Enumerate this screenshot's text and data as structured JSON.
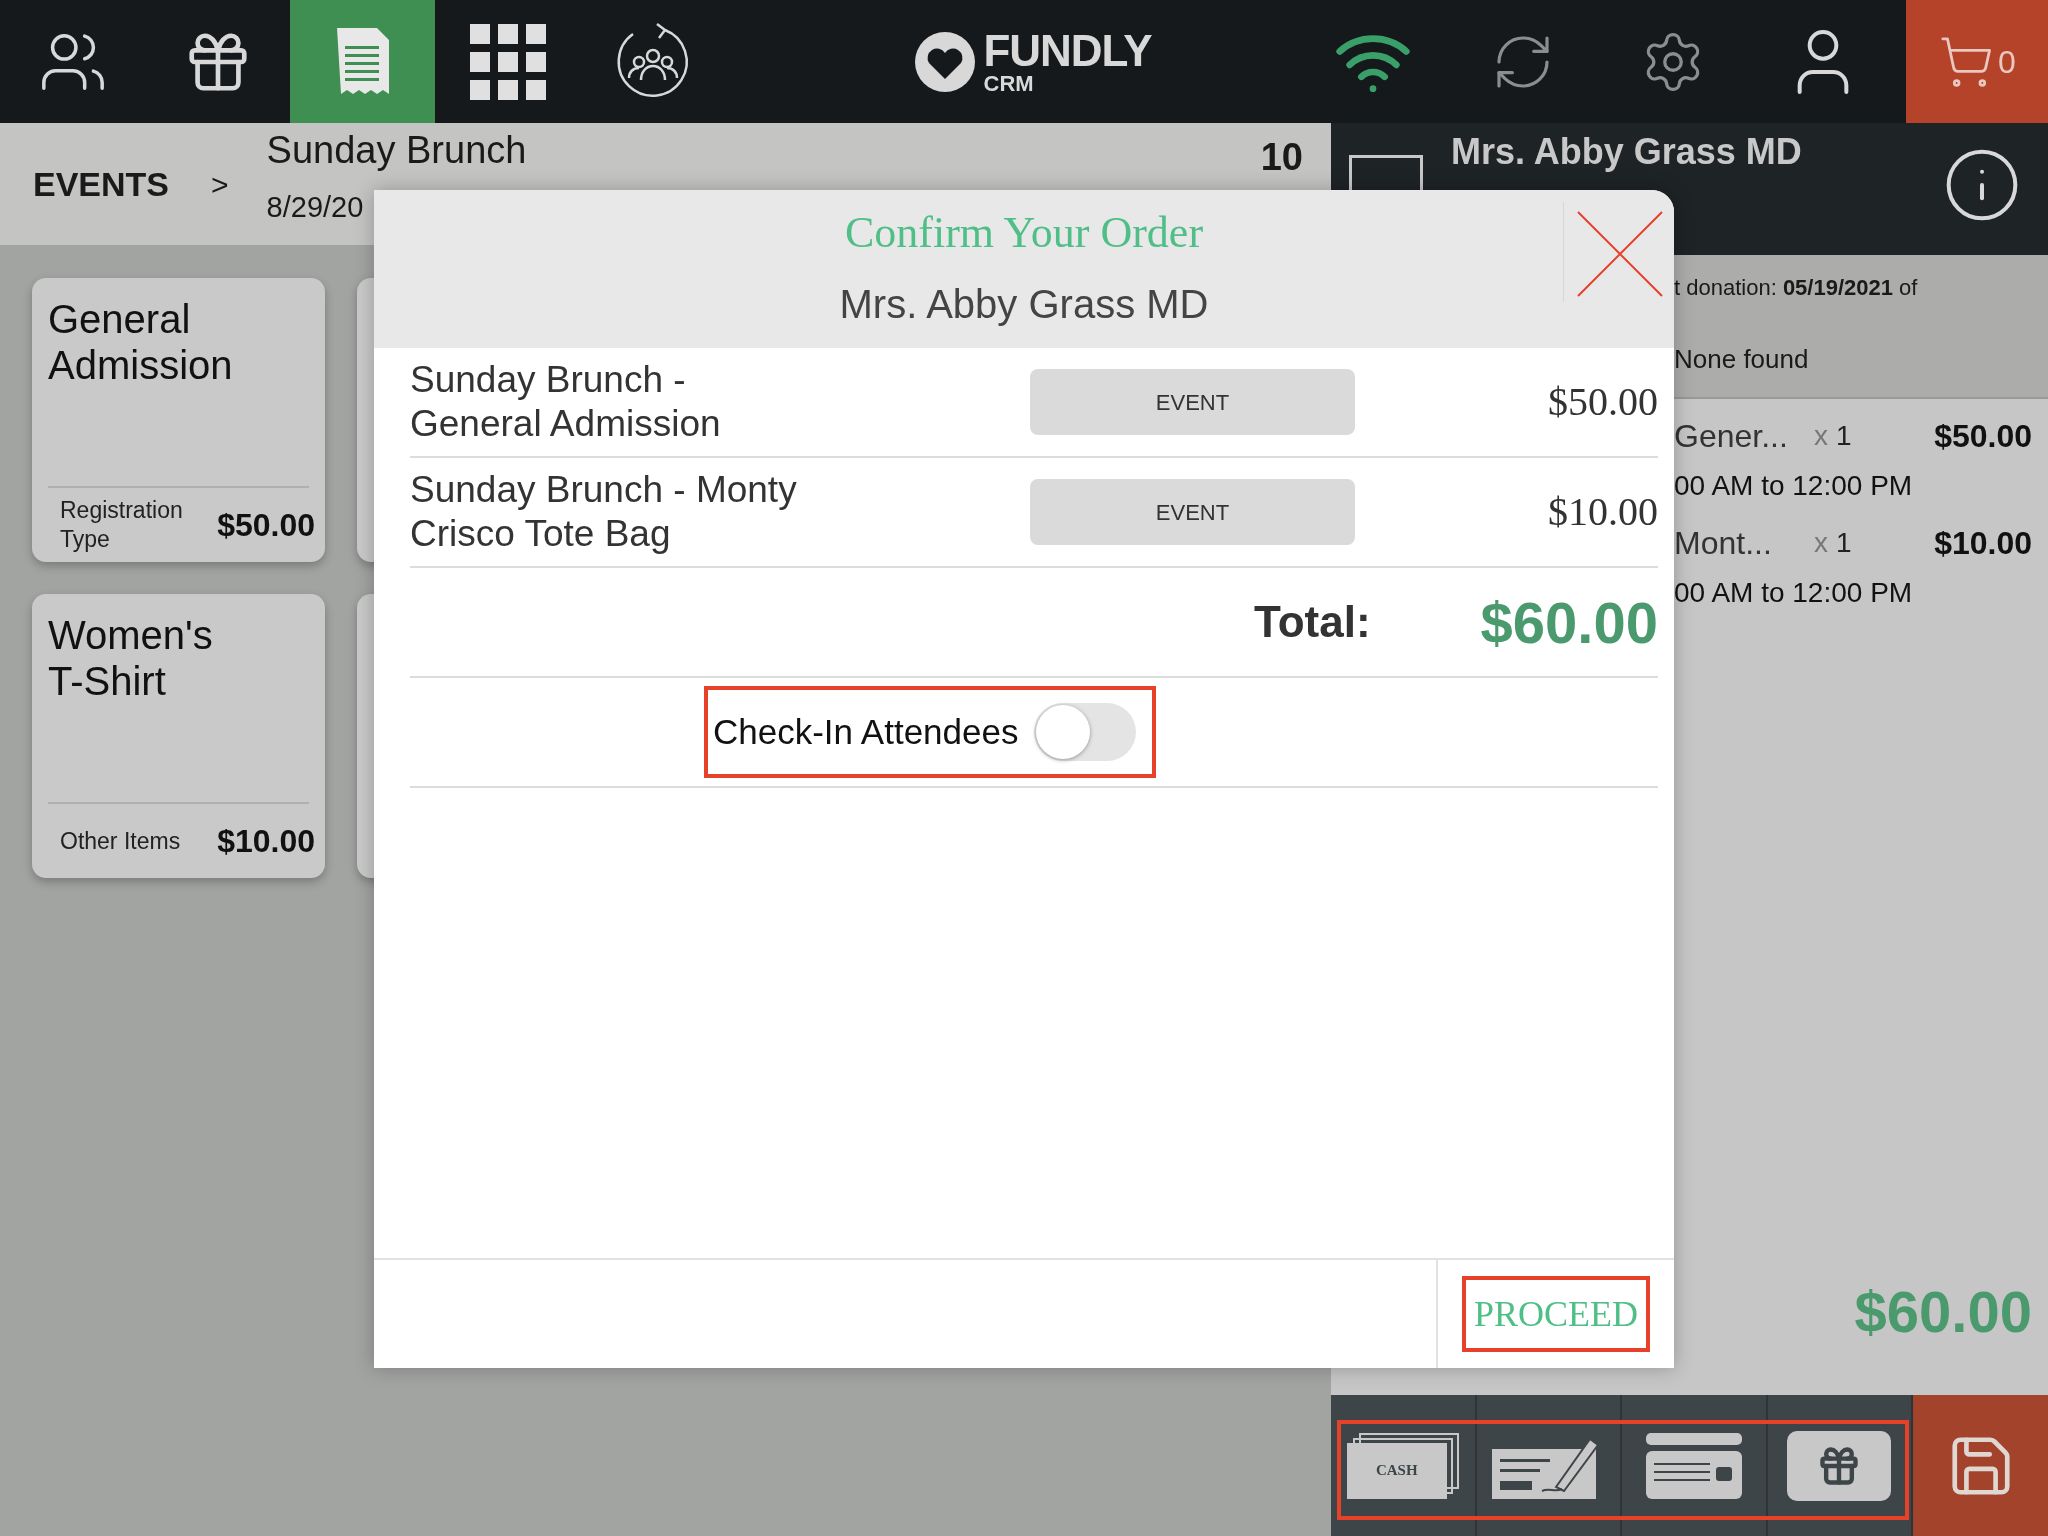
{
  "nav": [
    {
      "kind": "people",
      "selected": false
    },
    {
      "kind": "gift",
      "selected": false
    },
    {
      "kind": "receipt",
      "selected": true
    },
    {
      "kind": "grid",
      "selected": false
    },
    {
      "kind": "cycle",
      "selected": false
    }
  ],
  "logo": {
    "name": "FUNDLY",
    "sub": "CRM"
  },
  "status": {
    "cart_count": "0"
  },
  "breadcrumb": {
    "root": "EVENTS",
    "sep": ">",
    "event": "Sunday Brunch",
    "date": "8/29/20",
    "count": "10"
  },
  "cards": [
    {
      "title": "General Admission",
      "type": "Registration Type",
      "price": "$50.00"
    },
    {
      "title": "Women's T-Shirt",
      "type": "Other Items",
      "price": "$10.00"
    }
  ],
  "customer": {
    "name": "Mrs. Abby Grass MD",
    "donation": "t donation: **05/19/2021** of",
    "note": "None found"
  },
  "cart": [
    {
      "name": "Gener...",
      "qty": "x",
      "count": "1",
      "price": "$50.00",
      "time": "00 AM to 12:00 PM"
    },
    {
      "name": "Mont...",
      "qty": "x",
      "count": "1",
      "price": "$10.00",
      "time": "00 AM to 12:00 PM"
    }
  ],
  "cart_total": "$60.00",
  "payments": [
    {
      "kind": "cash",
      "label": "CASH"
    },
    {
      "kind": "check"
    },
    {
      "kind": "card"
    },
    {
      "kind": "gift"
    }
  ],
  "modal": {
    "title": "Confirm Your Order",
    "customer": "Mrs. Abby Grass MD",
    "items": [
      {
        "name": "Sunday Brunch - General Admission",
        "tag": "EVENT",
        "price": "$50.00"
      },
      {
        "name": "Sunday Brunch - Monty Crisco Tote Bag",
        "tag": "EVENT",
        "price": "$10.00"
      }
    ],
    "total_label": "Total:",
    "total": "$60.00",
    "toggle": {
      "label": "Check-In Attendees",
      "on": false
    },
    "proceed": "PROCEED"
  }
}
